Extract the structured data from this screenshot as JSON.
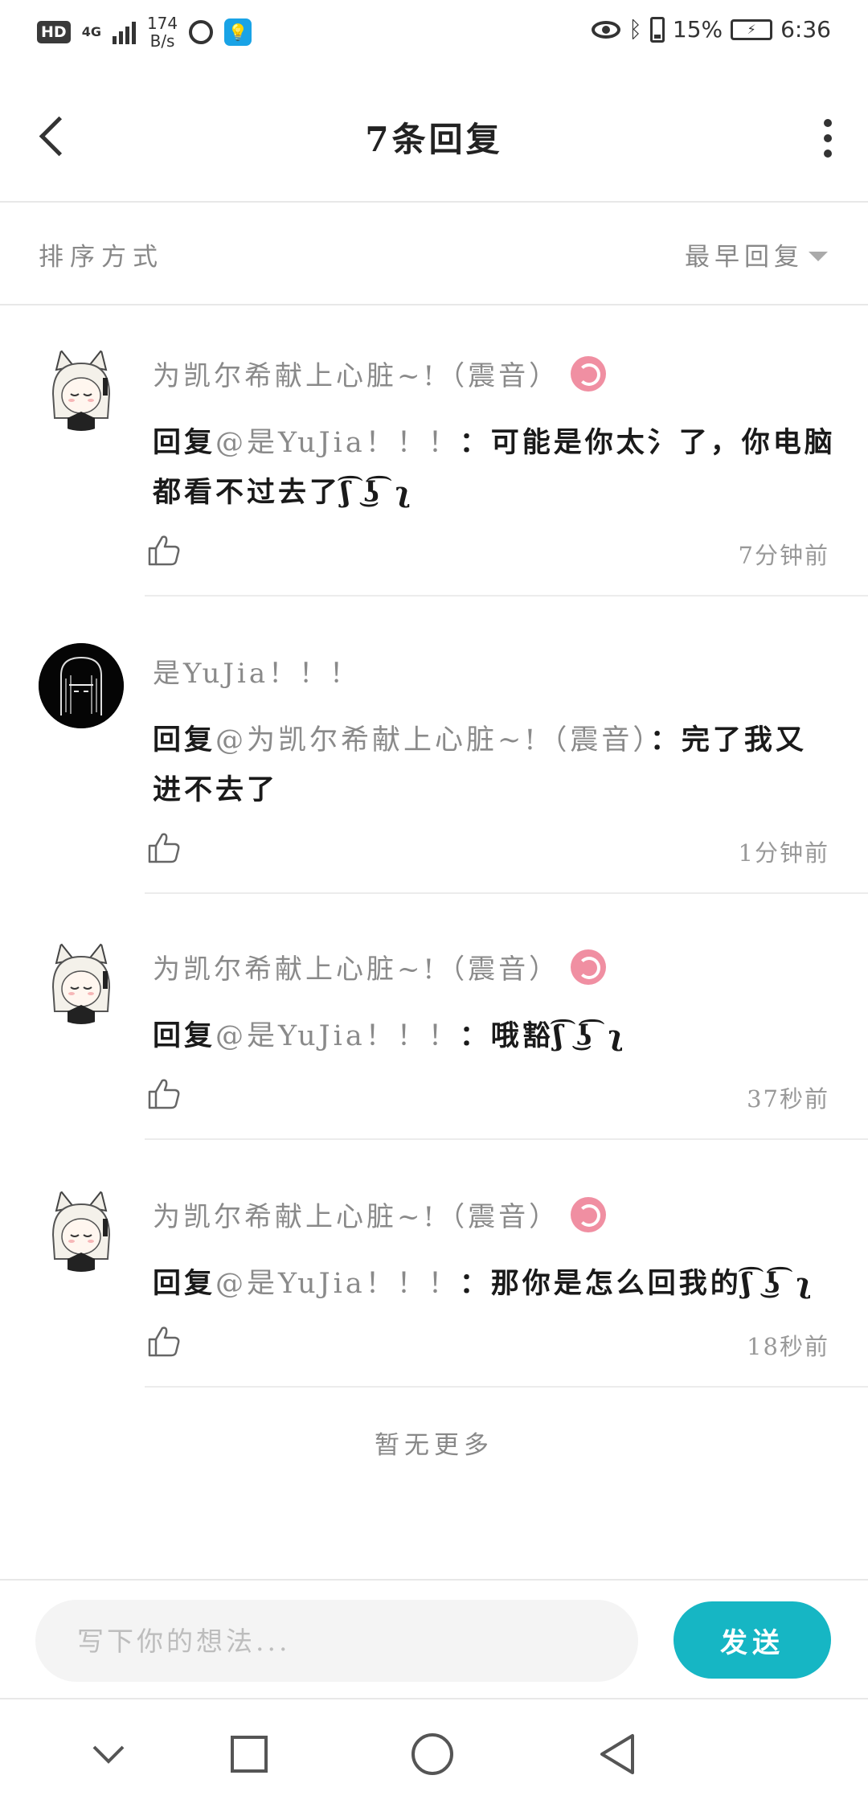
{
  "status_bar": {
    "hd": "HD",
    "network": "4G",
    "speed_value": "174",
    "speed_unit": "B/s",
    "battery_percent": "15%",
    "time": "6:36"
  },
  "header": {
    "title": "7条回复"
  },
  "sort": {
    "label": "排序方式",
    "value": "最早回复"
  },
  "comments": [
    {
      "name": "为凯尔希献上心脏~!（震音）",
      "reply_prefix": "回复",
      "mention": "@是YuJia！！！",
      "text": "：可能是你太氵了，你电脑都看不过去了ʃ͡ ͜ʖ͡ ʅ",
      "time": "7分钟前",
      "avatar": "anime-girl",
      "has_badge": true
    },
    {
      "name": "是YuJia！！！",
      "reply_prefix": "回复",
      "mention": "@为凯尔希献上心脏~!（震音）",
      "text": "：完了我又进不去了",
      "time": "1分钟前",
      "avatar": "dark-figure",
      "has_badge": false
    },
    {
      "name": "为凯尔希献上心脏~!（震音）",
      "reply_prefix": "回复",
      "mention": "@是YuJia！！！",
      "text": "：哦豁ʃ͡ ͜ʖ͡ ʅ",
      "time": "37秒前",
      "avatar": "anime-girl",
      "has_badge": true
    },
    {
      "name": "为凯尔希献上心脏~!（震音）",
      "reply_prefix": "回复",
      "mention": "@是YuJia！！！",
      "text": "：那你是怎么回我的ʃ͡ ͜ʖ͡ ʅ",
      "time": "18秒前",
      "avatar": "anime-girl",
      "has_badge": true
    }
  ],
  "footer_note": "暂无更多",
  "input": {
    "placeholder": "写下你的想法...",
    "send_label": "发送"
  },
  "colors": {
    "accent": "#16b6c4",
    "badge": "#f08fa2",
    "muted_text": "#8a8a8a"
  }
}
